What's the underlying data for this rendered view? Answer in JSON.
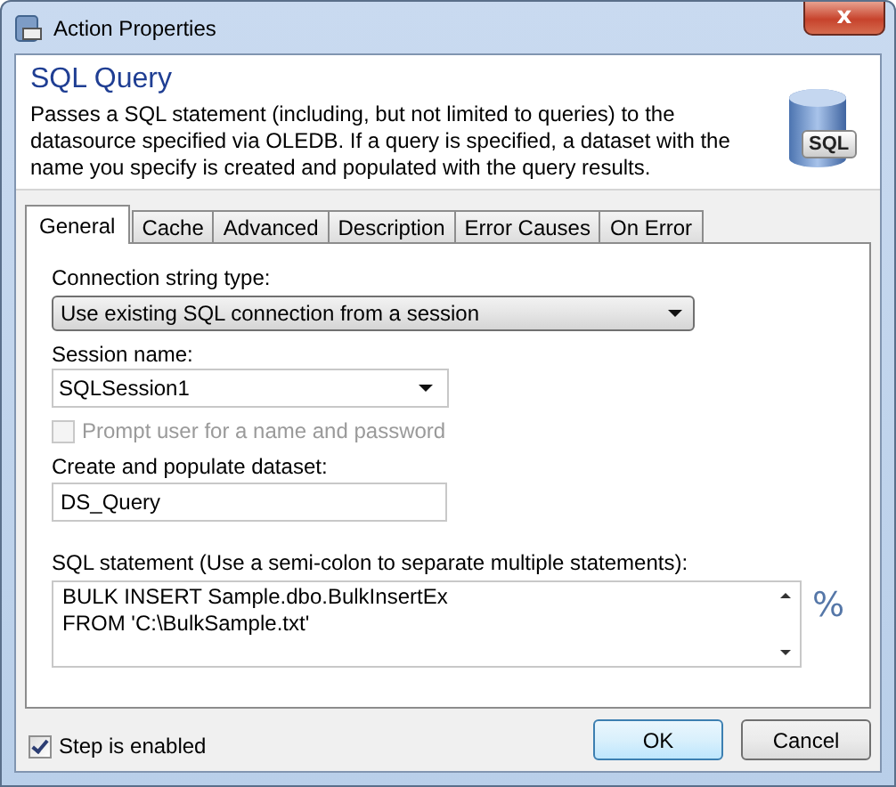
{
  "window": {
    "title": "Action Properties",
    "close_glyph": "x"
  },
  "header": {
    "title": "SQL Query",
    "description": "Passes a SQL statement (including, but not limited to queries) to the datasource specified via OLEDB.  If a query is specified, a dataset with the name you specify is created and populated with the query results.",
    "badge": "SQL"
  },
  "tabs": [
    {
      "label": "General",
      "selected": true
    },
    {
      "label": "Cache",
      "selected": false
    },
    {
      "label": "Advanced",
      "selected": false
    },
    {
      "label": "Description",
      "selected": false
    },
    {
      "label": "Error Causes",
      "selected": false
    },
    {
      "label": "On Error",
      "selected": false
    }
  ],
  "general": {
    "connection_type": {
      "label": "Connection string type:",
      "value": "Use existing SQL connection from a session"
    },
    "session": {
      "label": "Session name:",
      "value": "SQLSession1"
    },
    "prompt": {
      "label": "Prompt user for a name and password",
      "checked": false,
      "disabled": true
    },
    "dataset": {
      "label": "Create and populate dataset:",
      "value": "DS_Query"
    },
    "sql": {
      "label": "SQL statement (Use a semi-colon to separate multiple statements):",
      "lines": [
        "BULK INSERT Sample.dbo.BulkInsertEx",
        "FROM 'C:\\BulkSample.txt'"
      ],
      "variables_button": "%"
    }
  },
  "footer": {
    "step_enabled": {
      "label": "Step is enabled",
      "checked": true
    },
    "buttons": [
      {
        "label": "OK",
        "default": true
      },
      {
        "label": "Cancel",
        "default": false
      }
    ]
  }
}
